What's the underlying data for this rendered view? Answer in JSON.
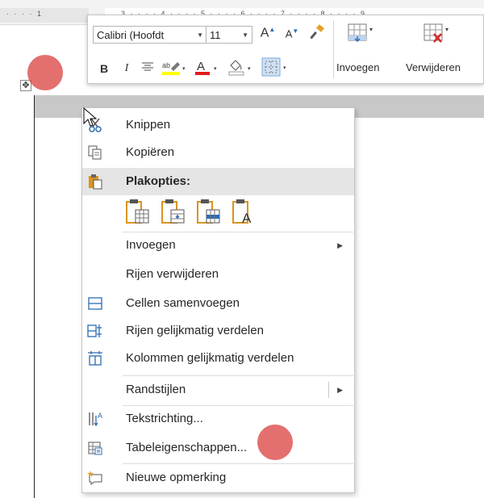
{
  "ruler": {
    "ticks_left": "· · · · 1",
    "ticks_right": "3 · · · · 4 · · · · 5 · · · · 6 · · · · 7 · · · · 8 · · · · 9"
  },
  "mini_toolbar": {
    "font_name": "Calibri (Hoofdt",
    "font_size": "11",
    "grow_font": "A",
    "shrink_font": "A",
    "bold": "B",
    "italic": "I",
    "font_color_letter": "A",
    "insert_label": "Invoegen",
    "delete_label": "Verwijderen"
  },
  "colors": {
    "highlight_yellow": "#ffff00",
    "font_red": "#e31b1b",
    "accent_blue": "#2b6cb5",
    "icon_orange": "#d9941e",
    "touch_dot": "#dc4646"
  },
  "context_menu": {
    "items": [
      {
        "label": "Knippen",
        "icon": "scissors-icon"
      },
      {
        "label": "Kopiëren",
        "icon": "copy-icon"
      },
      {
        "label": "Plakopties:",
        "icon": "paste-icon"
      },
      {
        "label": "Invoegen",
        "icon": ""
      },
      {
        "label": "Rijen verwijderen",
        "icon": ""
      },
      {
        "label": "Cellen samenvoegen",
        "icon": "merge-cells-icon"
      },
      {
        "label": "Rijen gelijkmatig verdelen",
        "icon": "distribute-rows-icon"
      },
      {
        "label": "Kolommen gelijkmatig verdelen",
        "icon": "distribute-columns-icon"
      },
      {
        "label": "Randstijlen",
        "icon": ""
      },
      {
        "label": "Tekstrichting...",
        "icon": "text-direction-icon"
      },
      {
        "label": "Tabeleigenschappen...",
        "icon": "table-properties-icon"
      },
      {
        "label": "Nieuwe opmerking",
        "icon": "new-comment-icon"
      }
    ],
    "paste_options": [
      {
        "icon": "paste-nested-table-icon"
      },
      {
        "icon": "paste-merge-table-icon"
      },
      {
        "icon": "paste-insert-rows-icon"
      },
      {
        "icon": "paste-keep-text-only-icon"
      }
    ]
  }
}
